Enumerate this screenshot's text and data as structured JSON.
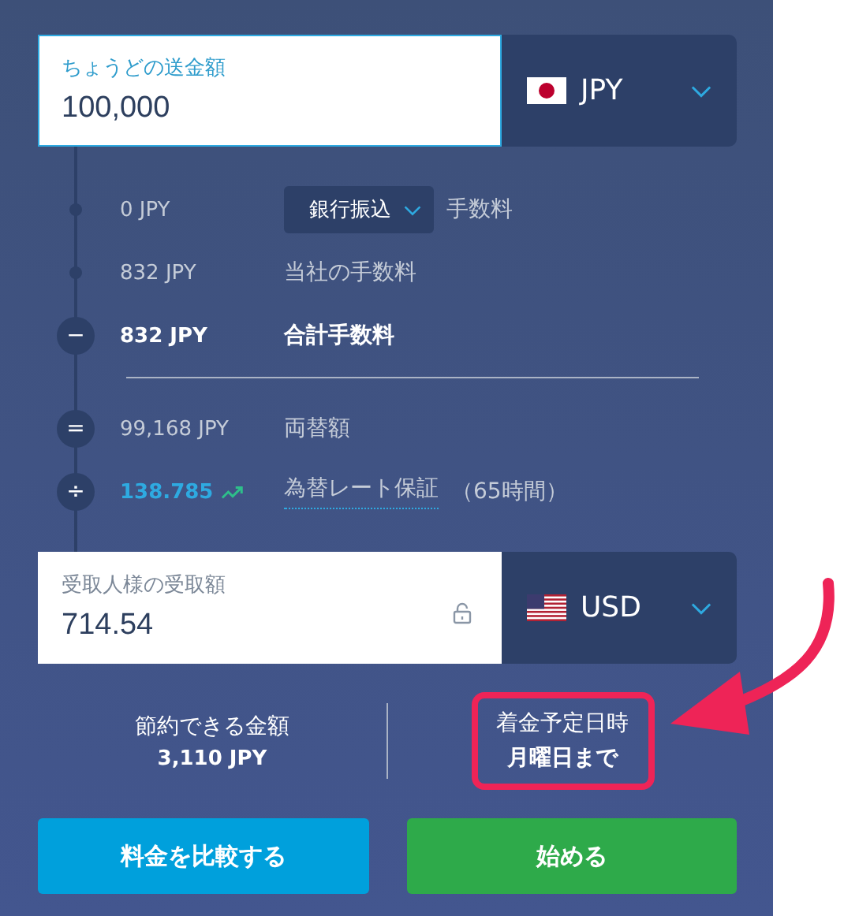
{
  "send": {
    "label": "ちょうどの送金額",
    "value": "100,000",
    "currency": "JPY",
    "flag": {
      "kind": "jp"
    },
    "focused": true
  },
  "fees": [
    {
      "kind": "fee",
      "amount": "0 JPY",
      "method": "銀行振込",
      "label": "手数料"
    },
    {
      "kind": "fee",
      "amount": "832 JPY",
      "label": "当社の手数料"
    },
    {
      "kind": "total",
      "symbol": "−",
      "amount": "832 JPY",
      "label": "合計手数料"
    },
    {
      "kind": "result",
      "symbol": "=",
      "amount": "99,168 JPY",
      "label": "両替額"
    },
    {
      "kind": "rate",
      "symbol": "÷",
      "amount": "138.785",
      "label": "為替レート保証",
      "note": "（65時間）"
    }
  ],
  "receive": {
    "label": "受取人様の受取額",
    "value": "714.54",
    "currency": "USD",
    "flag": {
      "kind": "us"
    },
    "focused": false
  },
  "summary": [
    {
      "title": "節約できる金額",
      "value": "3,110 JPY",
      "highlighted": false
    },
    {
      "title": "着金予定日時",
      "value": "月曜日まで",
      "highlighted": true
    }
  ],
  "buttons": [
    {
      "label": "料金を比較する",
      "kind": "secondary"
    },
    {
      "label": "始める",
      "kind": "primary"
    }
  ]
}
